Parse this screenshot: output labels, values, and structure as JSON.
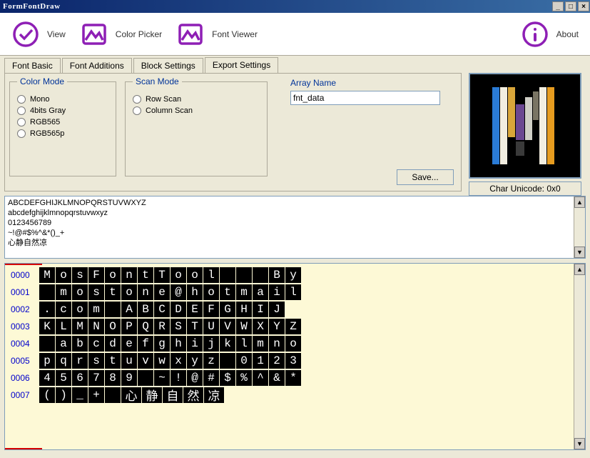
{
  "window": {
    "title": "FormFontDraw"
  },
  "toolbar": {
    "view": "View",
    "color_picker": "Color Picker",
    "font_viewer": "Font Viewer",
    "about": "About"
  },
  "tabs": [
    "Font Basic",
    "Font Additions",
    "Block Settings",
    "Export Settings"
  ],
  "active_tab": 3,
  "color_mode": {
    "legend": "Color Mode",
    "options": [
      "Mono",
      "4bits Gray",
      "RGB565",
      "RGB565p"
    ]
  },
  "scan_mode": {
    "legend": "Scan Mode",
    "options": [
      "Row Scan",
      "Column Scan"
    ]
  },
  "array_name": {
    "label": "Array Name",
    "value": "fnt_data"
  },
  "save_label": "Save...",
  "char_unicode": "Char Unicode: 0x0",
  "text_lines": [
    "",
    "ABCDEFGHIJKLMNOPQRSTUVWXYZ",
    "abcdefghijklmnopqrstuvwxyz",
    "0123456789",
    "~!@#$%^&*()_+",
    "心静自然凉"
  ],
  "grid_rows": [
    {
      "num": "0000",
      "cells": [
        "M",
        "o",
        "s",
        "F",
        "o",
        "n",
        "t",
        "T",
        "o",
        "o",
        "l",
        " ",
        " ",
        " ",
        "B",
        "y"
      ]
    },
    {
      "num": "0001",
      "cells": [
        " ",
        "m",
        "o",
        "s",
        "t",
        "o",
        "n",
        "e",
        "@",
        "h",
        "o",
        "t",
        "m",
        "a",
        "i",
        "l"
      ]
    },
    {
      "num": "0002",
      "cells": [
        ".",
        "c",
        "o",
        "m",
        " ",
        "A",
        "B",
        "C",
        "D",
        "E",
        "F",
        "G",
        "H",
        "I",
        "J"
      ]
    },
    {
      "num": "0003",
      "cells": [
        "K",
        "L",
        "M",
        "N",
        "O",
        "P",
        "Q",
        "R",
        "S",
        "T",
        "U",
        "V",
        "W",
        "X",
        "Y",
        "Z"
      ]
    },
    {
      "num": "0004",
      "cells": [
        " ",
        "a",
        "b",
        "c",
        "d",
        "e",
        "f",
        "g",
        "h",
        "i",
        "j",
        "k",
        "l",
        "m",
        "n",
        "o"
      ]
    },
    {
      "num": "0005",
      "cells": [
        "p",
        "q",
        "r",
        "s",
        "t",
        "u",
        "v",
        "w",
        "x",
        "y",
        "z",
        " ",
        "0",
        "1",
        "2",
        "3"
      ]
    },
    {
      "num": "0006",
      "cells": [
        "4",
        "5",
        "6",
        "7",
        "8",
        "9",
        " ",
        "~",
        "!",
        "@",
        "#",
        "$",
        "%",
        "^",
        "&",
        "*"
      ]
    },
    {
      "num": "0007",
      "cells": [
        "(",
        ")",
        "_",
        "+",
        " "
      ],
      "cjk": [
        "心",
        "静",
        "自",
        "然",
        "凉"
      ]
    }
  ]
}
